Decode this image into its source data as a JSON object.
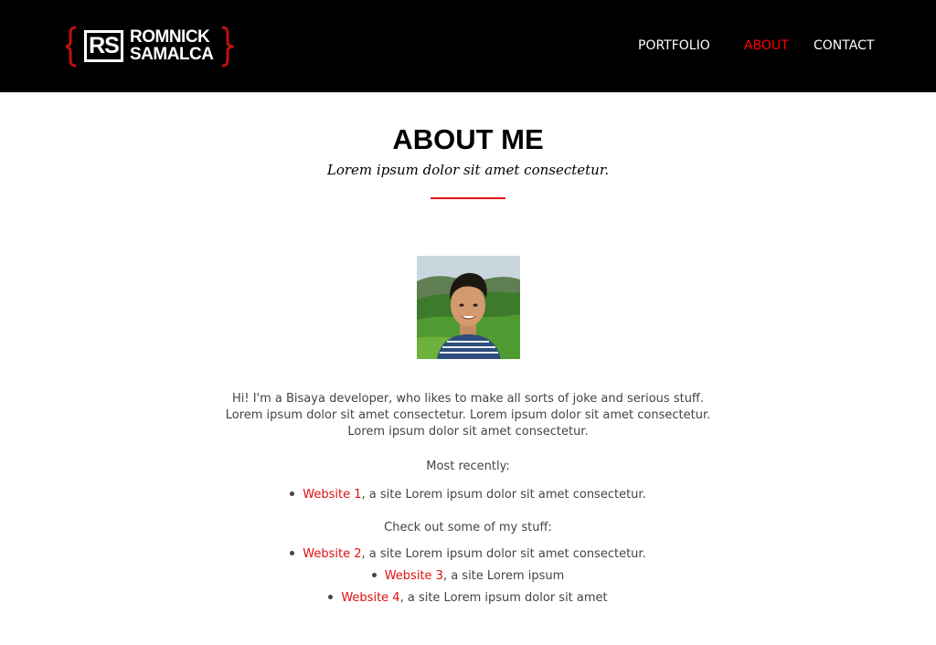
{
  "header": {
    "logo": {
      "monogram": "RS",
      "line1": "ROMNICK",
      "line2": "SAMALCA"
    },
    "nav": [
      {
        "label": "PORTFOLIO",
        "active": false
      },
      {
        "label": "ABOUT",
        "active": true
      },
      {
        "label": "CONTACT",
        "active": false
      }
    ]
  },
  "main": {
    "title": "ABOUT ME",
    "subtitle": "Lorem ipsum dolor sit amet consectetur.",
    "intro_lines": [
      "Hi! I'm a Bisaya developer, who likes to make all sorts of joke and serious stuff.",
      "Lorem ipsum dolor sit amet consectetur. Lorem ipsum dolor sit amet consectetur.",
      "Lorem ipsum dolor sit amet consectetur."
    ],
    "recent_label": "Most recently:",
    "recent": [
      {
        "link": "Website 1",
        "text": ", a site Lorem ipsum dolor sit amet consectetur."
      }
    ],
    "stuff_label": "Check out some of my stuff:",
    "stuff": [
      {
        "link": "Website 2",
        "text": ", a site Lorem ipsum dolor sit amet consectetur."
      },
      {
        "link": "Website 3",
        "text": ", a site Lorem ipsum"
      },
      {
        "link": "Website 4",
        "text": ", a site Lorem ipsum dolor sit amet"
      }
    ]
  },
  "colors": {
    "header_bg": "#000000",
    "accent": "#e01010",
    "body_text": "#444444"
  }
}
